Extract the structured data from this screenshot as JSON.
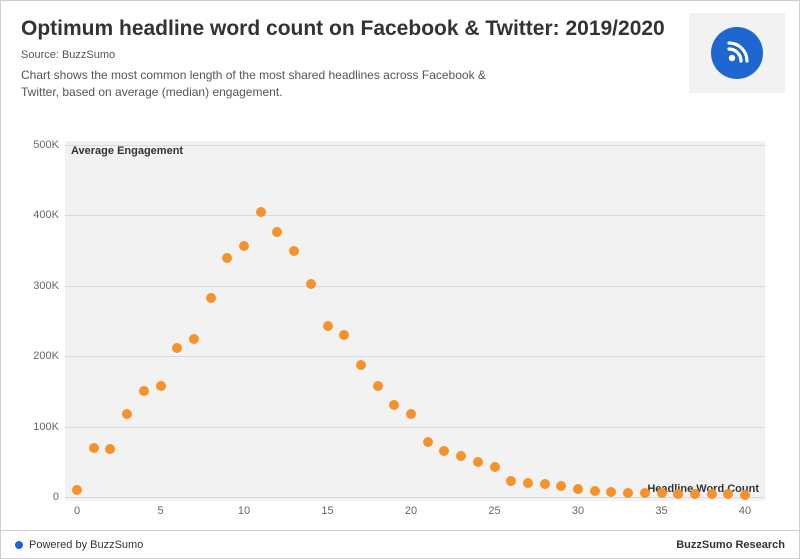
{
  "header": {
    "title": "Optimum headline word count on Facebook & Twitter: 2019/2020",
    "source": "Source: BuzzSumo",
    "subtitle": "Chart shows the most common length of the most shared headlines across Facebook & Twitter, based on average (median) engagement."
  },
  "footer": {
    "left": "Powered by BuzzSumo",
    "right": "BuzzSumo Research"
  },
  "chart_data": {
    "type": "scatter",
    "title": "Optimum headline word count on Facebook & Twitter: 2019/2020",
    "xlabel": "Headline Word Count",
    "ylabel": "Average Engagement",
    "xlim": [
      0,
      40
    ],
    "ylim": [
      0,
      500000
    ],
    "y_ticks": [
      0,
      100000,
      200000,
      300000,
      400000,
      500000
    ],
    "y_tick_labels": [
      "0",
      "100K",
      "200K",
      "300K",
      "400K",
      "500K"
    ],
    "x_ticks": [
      0,
      5,
      10,
      15,
      20,
      25,
      30,
      35,
      40
    ],
    "x": [
      0,
      1,
      2,
      3,
      4,
      5,
      6,
      7,
      8,
      9,
      10,
      11,
      12,
      13,
      14,
      15,
      16,
      17,
      18,
      19,
      20,
      21,
      22,
      23,
      24,
      25,
      26,
      27,
      28,
      29,
      30,
      31,
      32,
      33,
      34,
      35,
      36,
      37,
      38,
      39,
      40
    ],
    "values": [
      10000,
      70000,
      68000,
      118000,
      150000,
      158000,
      212000,
      225000,
      282000,
      340000,
      357000,
      405000,
      377000,
      350000,
      302000,
      243000,
      230000,
      187000,
      158000,
      130000,
      118000,
      78000,
      65000,
      58000,
      50000,
      42000,
      23000,
      20000,
      18000,
      15000,
      12000,
      8000,
      7000,
      6000,
      5000,
      5000,
      4000,
      4000,
      4000,
      4000,
      3000
    ],
    "series_color": "#f5922a"
  }
}
